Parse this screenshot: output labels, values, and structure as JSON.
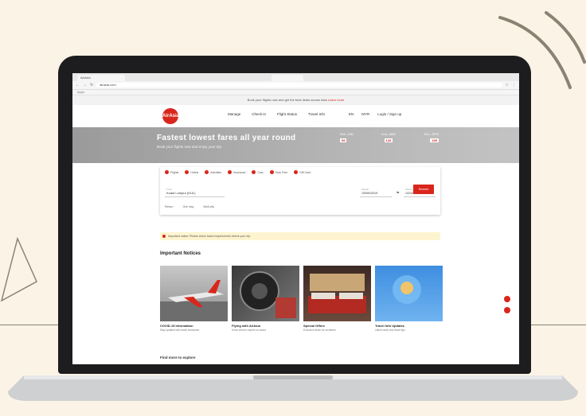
{
  "browser": {
    "tab_label": "AirAsia",
    "url": "airasia.com",
    "bookmarks": "Apps"
  },
  "site": {
    "logo_text": "AirAsia",
    "promo_text": "Book your flights now and get the best deals across Asia",
    "promo_link": "Learn more",
    "nav_items": [
      "Manage",
      "Check-in",
      "Flight Status",
      "Travel Info"
    ],
    "nav_right": [
      "EN",
      "MYR",
      "Login / Sign up"
    ]
  },
  "hero": {
    "title": "Fastest lowest fares all year round",
    "subtitle": "Book your flights now and enjoy your trip",
    "deals": [
      {
        "route": "KUL–SIN",
        "price": "99"
      },
      {
        "route": "KUL–BKK",
        "price": "129"
      },
      {
        "route": "KUL–DPS",
        "price": "199"
      }
    ]
  },
  "search": {
    "tabs": [
      "Flights",
      "Hotels",
      "Activities",
      "Insurance",
      "Cars",
      "Duty Free",
      "Gift Card"
    ],
    "from_label": "From",
    "from_value": "Kuala Lumpur (KUL)",
    "depart_label": "Depart",
    "depart_value": "25/09/2019",
    "return_label": "Return",
    "return_value": "02/10/2019",
    "button_label": "Search",
    "options": [
      "Return",
      "One way",
      "Multi-city"
    ]
  },
  "notice": {
    "text": "Important notice: Please check travel requirements before your trip"
  },
  "section": {
    "title": "Important Notices",
    "cards": [
      {
        "title": "COVID-19 Information",
        "text": "Stay updated with travel advisories"
      },
      {
        "title": "Flying with AirAsia",
        "text": "Know what to expect on board"
      },
      {
        "title": "Special Offers",
        "text": "Exclusive deals for members"
      },
      {
        "title": "Travel Info Updates",
        "text": "Latest news and travel tips"
      }
    ]
  },
  "bottom": {
    "title": "Find more to explore"
  },
  "colors": {
    "brand": "#d9261c",
    "background": "#fbf4e6",
    "laptop": "#1d1d1f"
  }
}
